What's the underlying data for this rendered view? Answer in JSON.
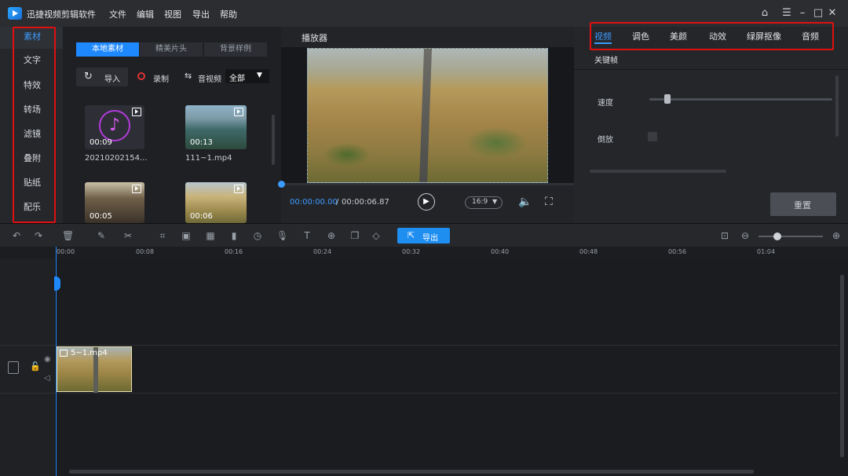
{
  "app": {
    "title": "迅捷视频剪辑软件"
  },
  "menu": [
    "文件",
    "编辑",
    "视图",
    "导出",
    "帮助"
  ],
  "sidebar": {
    "items": [
      "素材",
      "文字",
      "特效",
      "转场",
      "滤镜",
      "叠附",
      "贴纸",
      "配乐"
    ],
    "active": 0
  },
  "media": {
    "tabs": [
      "本地素材",
      "精美片头",
      "背景样例"
    ],
    "import_label": "导入",
    "record_label": "录制",
    "filter_label": "音视频",
    "filter_value": "全部",
    "items": [
      {
        "name": "20210202154...",
        "duration": "00:09",
        "kind": "audio"
      },
      {
        "name": "111~1.mp4",
        "duration": "00:13",
        "kind": "video"
      },
      {
        "name": "",
        "duration": "00:05",
        "kind": "video"
      },
      {
        "name": "",
        "duration": "00:06",
        "kind": "video"
      }
    ]
  },
  "player": {
    "title": "播放器",
    "current_time": "00:00:00.00",
    "separator": "/",
    "total_time": "00:00:06.87",
    "aspect": "16:9"
  },
  "props": {
    "tabs": [
      "视频",
      "调色",
      "美颜",
      "动效",
      "绿屏抠像",
      "音频"
    ],
    "active_tab": 0,
    "keyframe_label": "关键帧",
    "speed_label": "速度",
    "reverse_label": "倒放",
    "reset_label": "重置"
  },
  "timeline": {
    "export_label": "导出",
    "ticks": [
      "00:00",
      "00:08",
      "00:16",
      "00:24",
      "00:32",
      "00:40",
      "00:48",
      "00:56",
      "01:04"
    ],
    "clip_name": "5~1.mp4"
  },
  "colors": {
    "accent": "#1e88ff",
    "highlight": "#e01010",
    "export_btn": "#1f8ef1"
  }
}
